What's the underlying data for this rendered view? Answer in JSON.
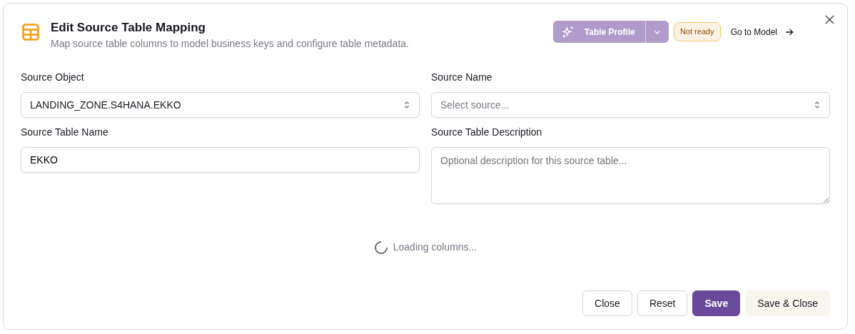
{
  "dialog": {
    "title": "Edit Source Table Mapping",
    "subtitle": "Map source table columns to model business keys and configure table metadata."
  },
  "header_actions": {
    "profile_button": {
      "label": "Table Profile",
      "disabled": true
    },
    "status_badge": "Not ready",
    "link": "Go to Model"
  },
  "fields": [
    {
      "label": "Source Object",
      "kind": "select",
      "value": "LANDING_ZONE.S4HANA.EKKO"
    },
    {
      "label": "Source Name",
      "kind": "select",
      "placeholder": "Select source..."
    },
    {
      "label": "Source Table Name",
      "kind": "input",
      "value": "EKKO"
    },
    {
      "label": "Source Table Description",
      "kind": "textarea",
      "placeholder": "Optional description for this source table..."
    }
  ],
  "loading": "Loading columns...",
  "buttons": [
    {
      "label": "Close",
      "kind": "outline"
    },
    {
      "label": "Reset",
      "kind": "outline"
    },
    {
      "label": "Save",
      "kind": "primary"
    },
    {
      "label": "Save & Close",
      "kind": "soft"
    }
  ]
}
